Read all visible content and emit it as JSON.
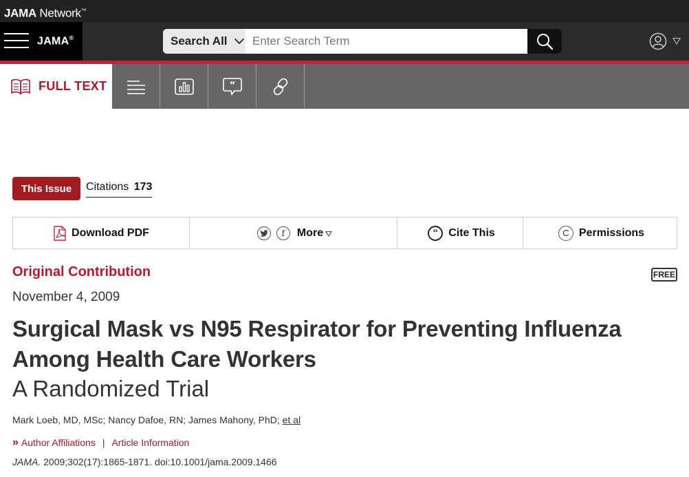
{
  "network": {
    "logo_bold": "JAMA",
    "logo_rest": "Network",
    "logo_mark": "™"
  },
  "header": {
    "brand": "JAMA",
    "brand_mark": "®",
    "search_scope": "Search All",
    "search_placeholder": "Enter Search Term"
  },
  "tabs": {
    "full_text_label": "FULL TEXT",
    "icons": [
      "outline-list-icon",
      "figures-chart-icon",
      "comments-quote-icon",
      "related-link-icon"
    ]
  },
  "issue": {
    "this_issue_label": "This Issue",
    "citations_label": "Citations",
    "citations_count": "173"
  },
  "actions": {
    "download_pdf": "Download PDF",
    "more": "More",
    "cite_this": "Cite This",
    "permissions": "Permissions"
  },
  "article": {
    "type": "Original Contribution",
    "free_badge": "FREE",
    "date": "November 4, 2009",
    "title": "Surgical Mask vs N95 Respirator for Preventing Influenza Among Health Care Workers",
    "subtitle": "A Randomized Trial",
    "authors": "Mark Loeb, MD, MSc; Nancy Dafoe, RN; James Mahony, PhD;",
    "et_al": "et al",
    "author_affiliations": "Author Affiliations",
    "separator": "|",
    "article_information": "Article Information",
    "journal": "JAMA.",
    "citation": "2009;302(17):1865-1871. doi:10.1001/jama.2009.1466"
  },
  "colors": {
    "accent_red": "#c5203f",
    "issue_red": "#a31b21",
    "header_dark": "#2b2b2b",
    "tab_gray": "#666666"
  }
}
